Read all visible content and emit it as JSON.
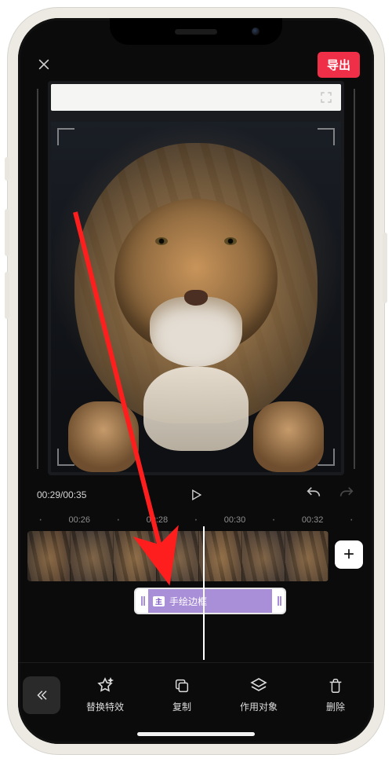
{
  "header": {
    "export_label": "导出"
  },
  "playback": {
    "current": "00:29",
    "total": "00:35"
  },
  "ruler": {
    "t1": "00:26",
    "t2": "00:28",
    "t3": "00:30",
    "t4": "00:32"
  },
  "effect": {
    "badge": "主",
    "name": "手绘边框"
  },
  "add_button": "+",
  "toolbar": {
    "replace_effect": "替换特效",
    "copy": "复制",
    "target": "作用对象",
    "delete": "删除"
  }
}
